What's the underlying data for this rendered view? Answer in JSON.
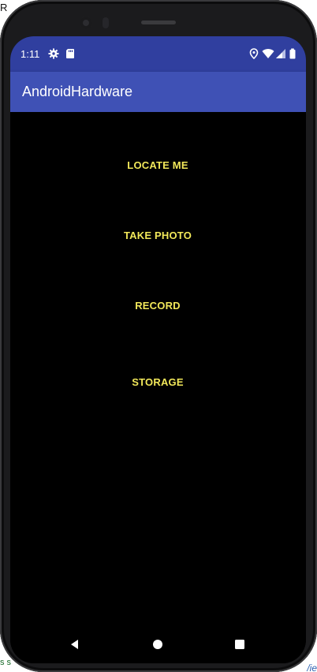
{
  "corner_labels": {
    "top_left": "R",
    "bottom_left": "s s",
    "bottom_right": "/ie"
  },
  "status_bar": {
    "time": "1:11",
    "icons": [
      "gear-icon",
      "sd-card-icon",
      "location-icon",
      "wifi-icon",
      "signal-icon",
      "battery-icon"
    ]
  },
  "app_bar": {
    "title": "AndroidHardware"
  },
  "buttons": {
    "locate": "LOCATE ME",
    "photo": "TAKE PHOTO",
    "record": "RECORD",
    "storage": "STORAGE"
  },
  "navigation": {
    "icons": [
      "back-icon",
      "home-icon",
      "recents-icon"
    ]
  },
  "colors": {
    "status_bar": "#303f9f",
    "app_bar": "#3f51b5",
    "button_text": "#f2e85a",
    "background": "#000000"
  }
}
